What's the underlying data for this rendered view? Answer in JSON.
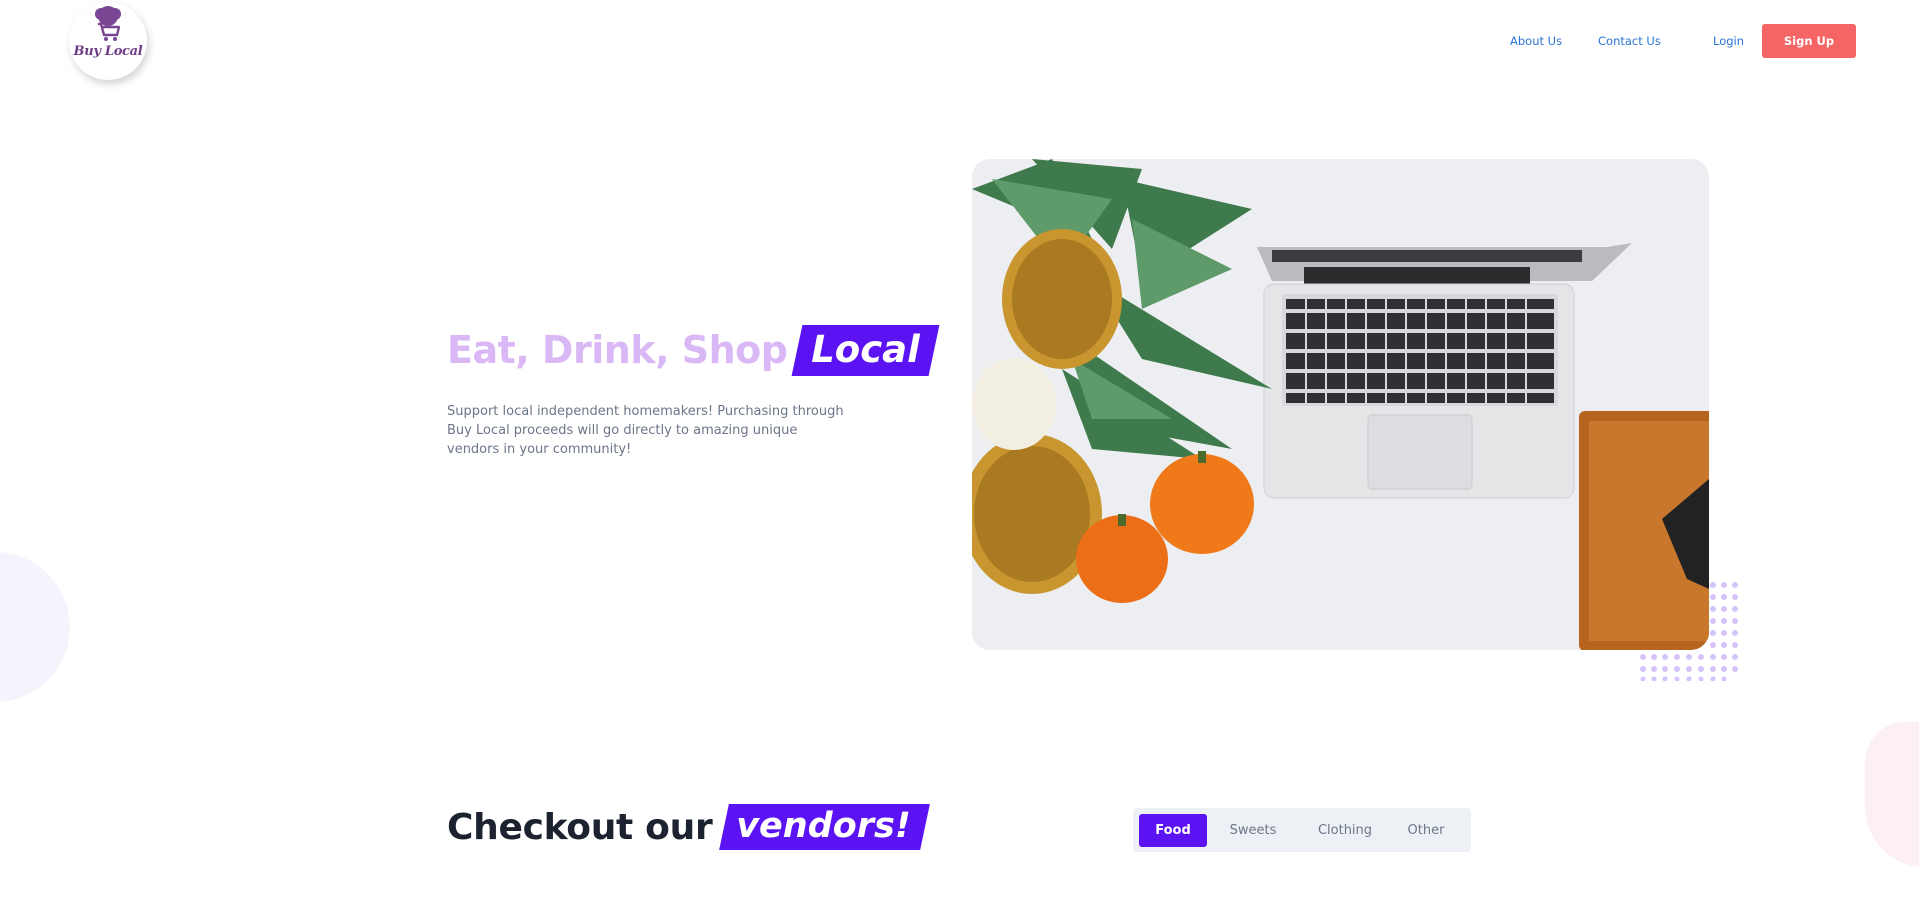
{
  "brand": {
    "logo_text": "Buy Local"
  },
  "nav": {
    "about": "About Us",
    "contact": "Contact Us",
    "login": "Login",
    "signup": "Sign Up"
  },
  "hero": {
    "title_prefix": "Eat, Drink, Shop",
    "title_highlight": "Local",
    "description": "Support local independent homemakers! Purchasing through Buy Local proceeds will go directly to amazing unique vendors in your community!"
  },
  "vendors": {
    "title_prefix": "Checkout our",
    "title_highlight": "vendors!",
    "tabs": [
      {
        "label": "Food",
        "active": true
      },
      {
        "label": "Sweets",
        "active": false
      },
      {
        "label": "Clothing",
        "active": false
      },
      {
        "label": "Other",
        "active": false
      }
    ]
  },
  "colors": {
    "accent": "#5c13f3",
    "signup": "#f56565",
    "nav_link": "#2b74d6",
    "muted_title": "#d9b8f5",
    "logo": "#6e3d87"
  }
}
